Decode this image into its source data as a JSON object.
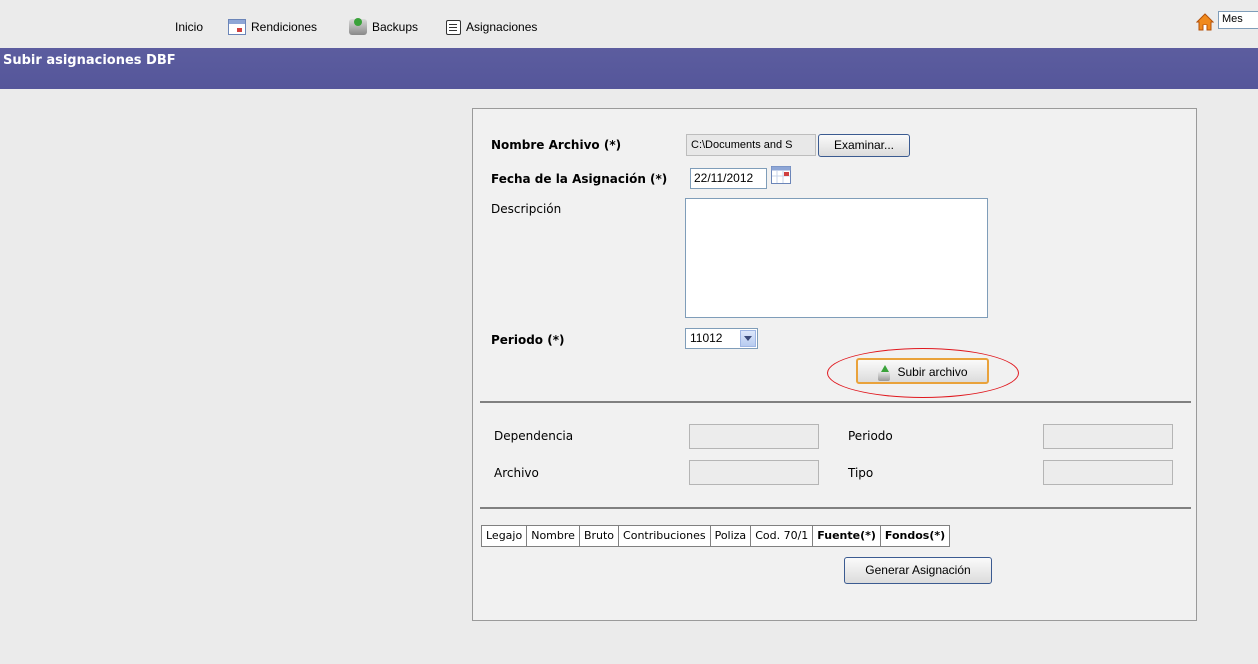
{
  "nav": {
    "inicio": "Inicio",
    "rendiciones": "Rendiciones",
    "backups": "Backups",
    "asignaciones": "Asignaciones",
    "mes_select": "Mes"
  },
  "header": {
    "title": "Subir asignaciones DBF"
  },
  "form": {
    "nombre_archivo_label": "Nombre Archivo (*)",
    "nombre_archivo_value": "C:\\Documents and S",
    "examinar_label": "Examinar...",
    "fecha_label": "Fecha de la Asignación (*)",
    "fecha_value": "22/11/2012",
    "descripcion_label": "Descripción",
    "descripcion_value": "",
    "periodo_label": "Periodo (*)",
    "periodo_value": "11012",
    "subir_label": "Subir archivo"
  },
  "info": {
    "dependencia_label": "Dependencia",
    "periodo_label": "Periodo",
    "archivo_label": "Archivo",
    "tipo_label": "Tipo"
  },
  "grid": {
    "columns": [
      "Legajo",
      "Nombre",
      "Bruto",
      "Contribuciones",
      "Poliza",
      "Cod. 70/1",
      "Fuente(*)",
      "Fondos(*)"
    ]
  },
  "actions": {
    "generar_label": "Generar Asignación"
  },
  "colors": {
    "header_bg": "#5c5d9f",
    "highlight_ellipse": "#e0181e",
    "upload_border": "#e9a23b"
  }
}
